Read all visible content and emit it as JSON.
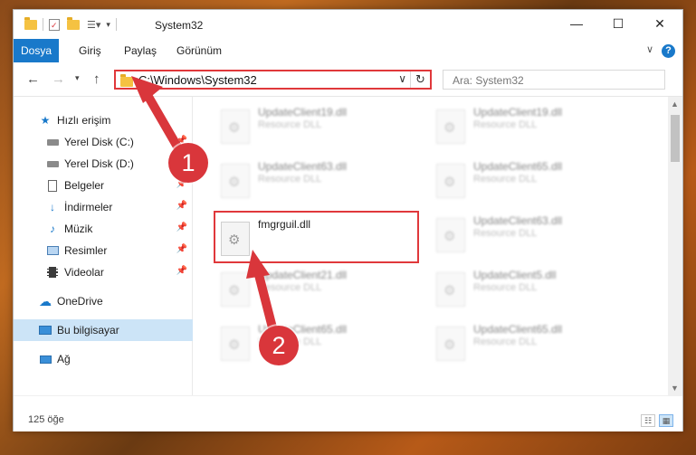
{
  "window": {
    "title": "System32",
    "controls": {
      "minimize": "—",
      "maximize": "☐",
      "close": "✕"
    }
  },
  "ribbon": {
    "tabs": [
      {
        "label": "Dosya"
      },
      {
        "label": "Giriş"
      },
      {
        "label": "Paylaş"
      },
      {
        "label": "Görünüm"
      }
    ],
    "help": "?"
  },
  "address": {
    "path": "C:\\Windows\\System32",
    "search_placeholder": "Ara: System32"
  },
  "nav": {
    "items": [
      {
        "label": "Hızlı erişim",
        "icon": "star-icon"
      },
      {
        "label": "Yerel Disk (C:)",
        "icon": "drive-icon"
      },
      {
        "label": "Yerel Disk (D:)",
        "icon": "drive-icon"
      },
      {
        "label": "Belgeler",
        "icon": "documents-icon"
      },
      {
        "label": "İndirmeler",
        "icon": "download-icon"
      },
      {
        "label": "Müzik",
        "icon": "music-icon"
      },
      {
        "label": "Resimler",
        "icon": "pictures-icon"
      },
      {
        "label": "Videolar",
        "icon": "videos-icon"
      },
      {
        "label": "OneDrive",
        "icon": "cloud-icon"
      },
      {
        "label": "Bu bilgisayar",
        "icon": "computer-icon"
      },
      {
        "label": "Ağ",
        "icon": "network-icon"
      }
    ]
  },
  "files": [
    {
      "name": "UpdateClient19.dll",
      "type": "Resource DLL"
    },
    {
      "name": "UpdateClient19.dll",
      "type": "Resource DLL"
    },
    {
      "name": "UpdateClient63.dll",
      "type": "Resource DLL"
    },
    {
      "name": "UpdateClient65.dll",
      "type": "Resource DLL"
    },
    {
      "name": "fmgrguil.dll",
      "type": ""
    },
    {
      "name": "UpdateClient63.dll",
      "type": "Resource DLL"
    },
    {
      "name": "UpdateClient21.dll",
      "type": "Resource DLL"
    },
    {
      "name": "UpdateClient5.dll",
      "type": "Resource DLL"
    },
    {
      "name": "UpdateClient65.dll",
      "type": "Resource DLL"
    },
    {
      "name": "UpdateClient65.dll",
      "type": "Resource DLL"
    }
  ],
  "status": {
    "count": "125 öğe"
  },
  "annotations": {
    "step1": "1",
    "step2": "2",
    "color": "#d9363b"
  },
  "colors": {
    "accent": "#1979ca",
    "highlight": "#e0383b",
    "selected": "#cce4f7"
  }
}
